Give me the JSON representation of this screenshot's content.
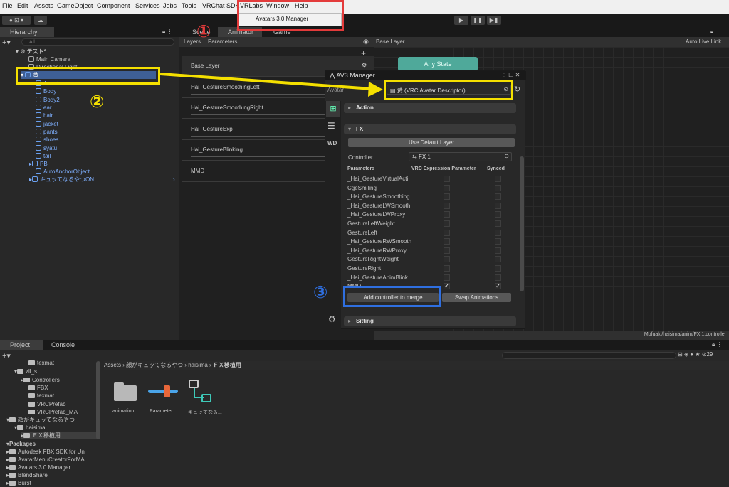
{
  "menubar": {
    "items": [
      "File",
      "Edit",
      "Assets",
      "GameObject",
      "Component",
      "Services",
      "Jobs",
      "Tools",
      "VRChat SDK",
      "VRLabs",
      "Window",
      "Help"
    ],
    "dropdown_item": "Avatars 3.0 Manager"
  },
  "hierarchy": {
    "tab": "Hierarchy",
    "search_placeholder": "All",
    "scene": "テスト*",
    "rows": [
      "Main Camera",
      "Directional Light",
      "黄",
      "Armature",
      "Body",
      "Body2",
      "ear",
      "hair",
      "jacket",
      "pants",
      "shoes",
      "syatu",
      "tail",
      "PB",
      "AutoAnchorObject",
      "キュッてなるやつON"
    ]
  },
  "animator": {
    "tabs": [
      "Scene",
      "Animator",
      "Game"
    ],
    "subtabs": [
      "Layers",
      "Parameters"
    ],
    "base_layer": "Base Layer",
    "auto_live_link": "Auto Live Link",
    "layers": [
      "Base Layer",
      "Hai_GestureSmoothingLeft",
      "Hai_GestureSmoothingRight",
      "Hai_GestureExp",
      "Hai_GestureBlinking",
      "MMD"
    ],
    "any_state": "Any State",
    "footer": "Mofuaki/haisima/anim/FX 1.controller"
  },
  "av3": {
    "title": "AV3 Manager",
    "avatar_label": "Avatar",
    "avatar_value": "黄 (VRC Avatar Descriptor)",
    "action": "Action",
    "fx": "FX",
    "use_default": "Use Default Layer",
    "controller_label": "Controller",
    "controller_value": "FX 1",
    "col_params": "Parameters",
    "col_vrc": "VRC Expression Parameter",
    "col_synced": "Synced",
    "params": [
      "_Hai_GestureVirtualActi",
      "CgeSmiling",
      "_Hai_GestureSmoothing",
      "_Hai_GestureLWSmooth",
      "_Hai_GestureLWProxy",
      "GestureLeftWeight",
      "GestureLeft",
      "_Hai_GestureRWSmooth",
      "_Hai_GestureRWProxy",
      "GestureRightWeight",
      "GestureRight",
      "_Hai_GestureAnimBlink",
      "MMD"
    ],
    "add_merge": "Add controller to merge",
    "swap": "Swap Animations",
    "sitting": "Sitting",
    "side_wd": "WD"
  },
  "project": {
    "tabs": [
      "Project",
      "Console"
    ],
    "breadcrumb": [
      "Assets",
      "顔がキュッてなるやつ",
      "haisima",
      "ＦＸ移植用"
    ],
    "tree": [
      "texmat",
      "zll_s",
      "Controllers",
      "FBX",
      "texmat",
      "VRCPrefab",
      "VRCPrefab_MA",
      "顔がキュッてなるやつ",
      "haisima",
      "ＦＸ移植用"
    ],
    "packages_label": "Packages",
    "packages": [
      "Autodesk FBX SDK for Un",
      "AvatarMenuCreatorForMA",
      "Avatars 3.0 Manager",
      "BlendShare",
      "Burst"
    ],
    "assets": [
      "animation",
      "Parameter",
      "キュッてなる..."
    ],
    "count": "29"
  },
  "annotations": {
    "one": "①",
    "two": "②",
    "three": "③",
    "yellow": "#f5e000",
    "red": "#e33b3b",
    "blue": "#2f6fe0"
  }
}
